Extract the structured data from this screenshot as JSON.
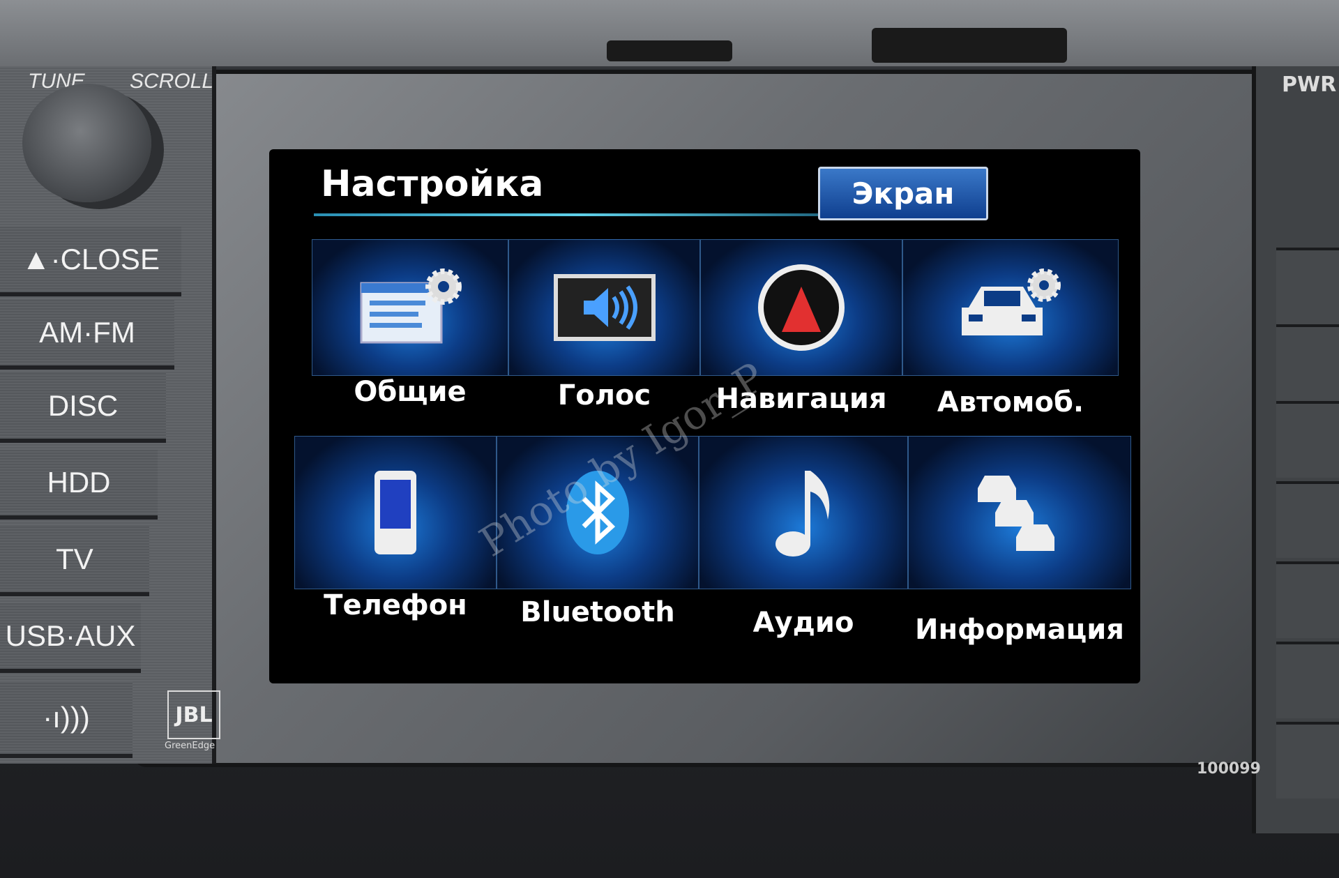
{
  "hardware": {
    "knob_labels": [
      "TUNE",
      "SCROLL"
    ],
    "buttons": [
      {
        "label": "▲·CLOSE"
      },
      {
        "label": "AM·FM"
      },
      {
        "label": "DISC"
      },
      {
        "label": "HDD"
      },
      {
        "label": "TV"
      },
      {
        "label": "USB·AUX"
      },
      {
        "label": "·ı)))"
      }
    ],
    "power_label": "PWR",
    "brand_logo": "JBL",
    "brand_sub": "GreenEdge",
    "serial": "100099"
  },
  "screen": {
    "title": "Настройка",
    "tab_button": "Экран",
    "items": [
      {
        "label": "Общие",
        "icon": "settings-window-gear-icon"
      },
      {
        "label": "Голос",
        "icon": "speaker-icon"
      },
      {
        "label": "Навигация",
        "icon": "compass-icon"
      },
      {
        "label": "Автомоб.",
        "icon": "car-gear-icon"
      },
      {
        "label": "Телефон",
        "icon": "phone-icon"
      },
      {
        "label": "Bluetooth",
        "icon": "bluetooth-icon"
      },
      {
        "label": "Аудио",
        "icon": "music-note-icon"
      },
      {
        "label": "Информация",
        "icon": "traffic-cars-icon"
      }
    ],
    "accent": "#1d7ad8"
  },
  "watermark": "Photo by Igor_P"
}
